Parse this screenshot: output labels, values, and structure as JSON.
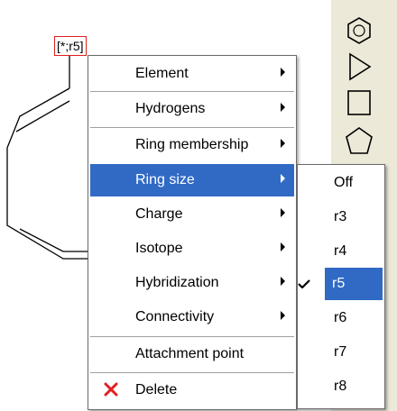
{
  "molecule": {
    "atom_query_label": "[*;r5]"
  },
  "context_menu": {
    "items": [
      {
        "label": "Element",
        "has_submenu": true
      },
      {
        "label": "Hydrogens",
        "has_submenu": true
      },
      {
        "label": "Ring membership",
        "has_submenu": true
      },
      {
        "label": "Ring size",
        "has_submenu": true,
        "highlighted": true
      },
      {
        "label": "Charge",
        "has_submenu": true
      },
      {
        "label": "Isotope",
        "has_submenu": true
      },
      {
        "label": "Hybridization",
        "has_submenu": true
      },
      {
        "label": "Connectivity",
        "has_submenu": true
      },
      {
        "label": "Attachment point",
        "has_submenu": false
      },
      {
        "label": "Delete",
        "has_submenu": false,
        "icon": "red-x-icon"
      }
    ]
  },
  "ring_size_submenu": {
    "items": [
      {
        "label": "Off"
      },
      {
        "label": "r3"
      },
      {
        "label": "r4"
      },
      {
        "label": "r5",
        "checked": true,
        "highlighted": true
      },
      {
        "label": "r6"
      },
      {
        "label": "r7"
      },
      {
        "label": "r8"
      }
    ]
  },
  "toolbar": {
    "icons": [
      "benzene-ring-icon",
      "triangle-icon",
      "square-icon",
      "pentagon-icon"
    ]
  },
  "colors": {
    "highlight": "#316ac5",
    "query_box": "#e02020",
    "delete_icon": "#e02020"
  }
}
